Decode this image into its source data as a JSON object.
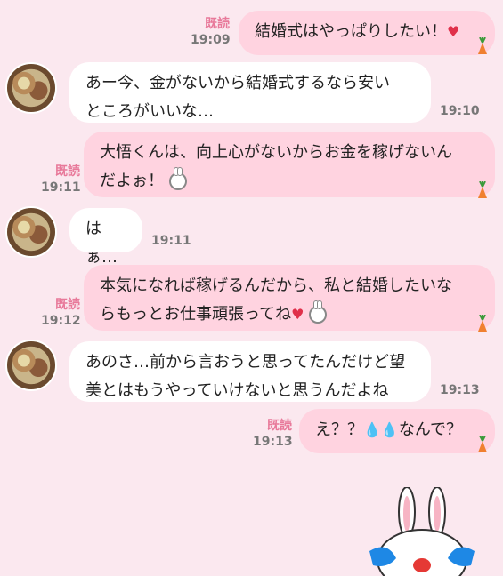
{
  "messages": [
    {
      "side": "me",
      "read": "既読",
      "time": "19:09",
      "text": "結婚式はやっぱりしたい！",
      "emoji": "heart-icon"
    },
    {
      "side": "them",
      "time": "19:10",
      "line1": "あー今、金がないから結婚式するなら安い",
      "line2": "ところがいいな…"
    },
    {
      "side": "me",
      "read": "既読",
      "time": "19:11",
      "line1": "大悟くんは、向上心がないからお金を稼げないん",
      "line2": "だよぉ！",
      "emoji": "bunny-icon"
    },
    {
      "side": "them",
      "time": "19:11",
      "text": "はぁ…"
    },
    {
      "side": "me",
      "read": "既読",
      "time": "19:12",
      "line1": "本気になれば稼げるんだから、私と結婚したいな",
      "line2": "らもっとお仕事頑張ってね",
      "emoji": "heart-icon bunny-icon"
    },
    {
      "side": "them",
      "time": "19:13",
      "line1": "あのさ…前から言おうと思ってたんだけど望",
      "line2": "美とはもうやっていけないと思うんだよね"
    },
    {
      "side": "me",
      "read": "既読",
      "time": "19:13",
      "text": "え？？",
      "text2": "なんで？",
      "emoji": "cry-icon"
    }
  ],
  "colors": {
    "background": "#fbe8ef",
    "my_bubble": "#ffd3e0",
    "their_bubble": "#ffffff",
    "read": "#e8799a"
  }
}
